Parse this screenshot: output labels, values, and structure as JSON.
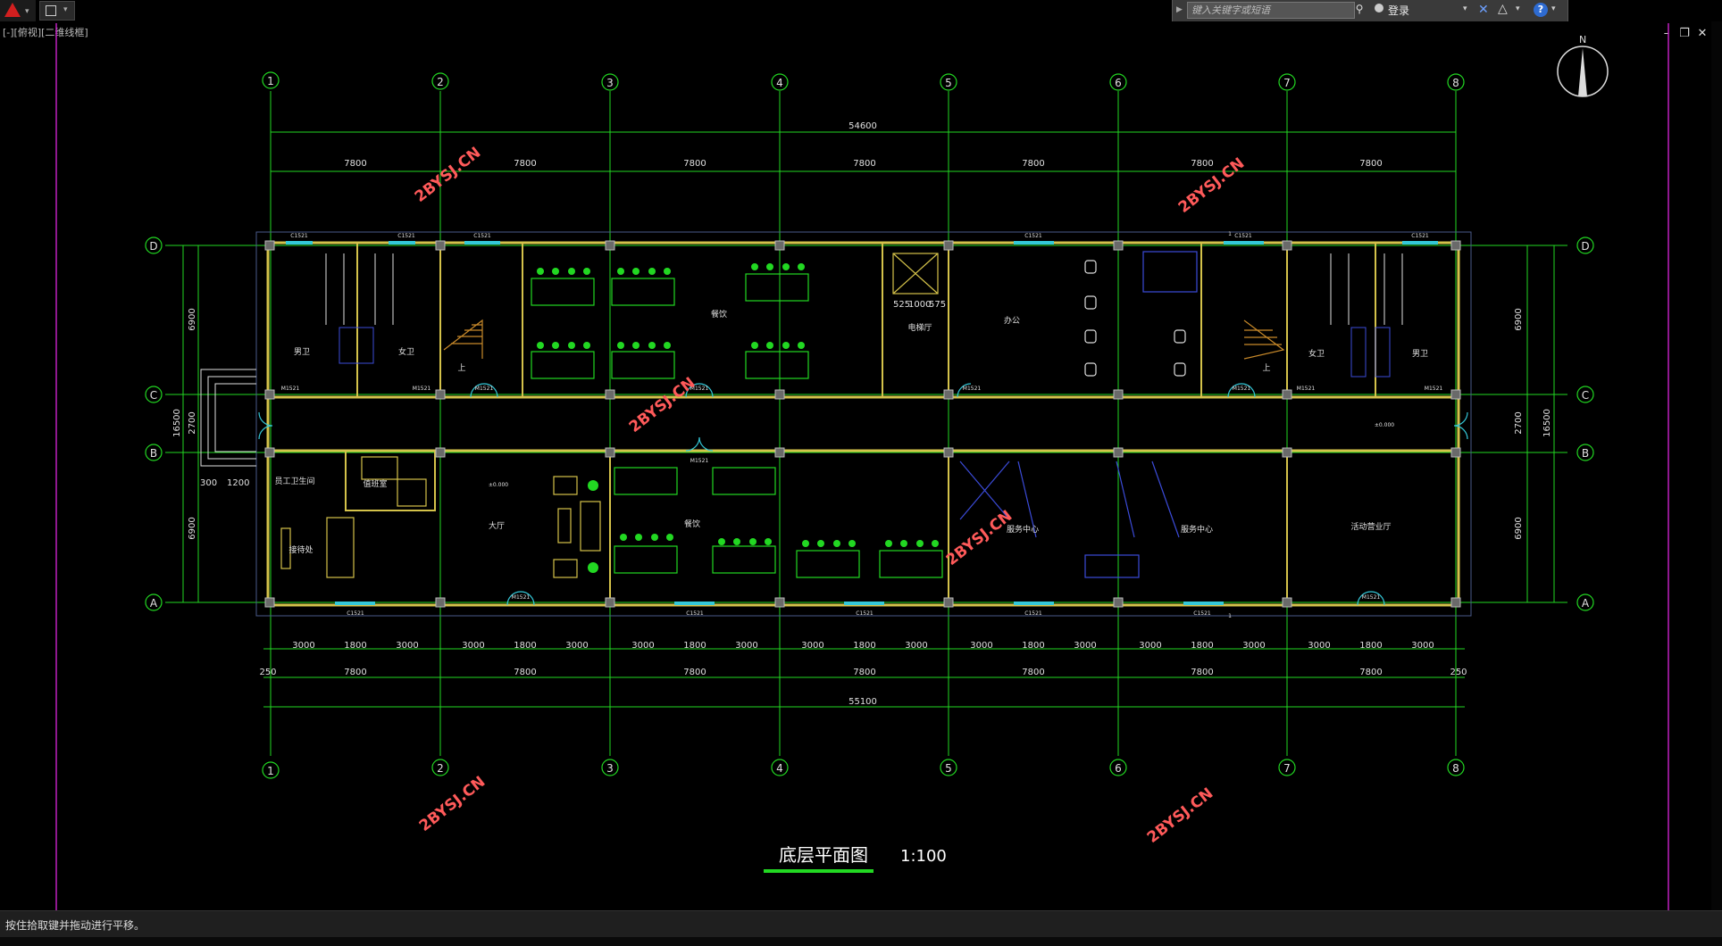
{
  "toolbar": {
    "app_logo": "autocad-a-icon",
    "search_placeholder": "键入关键字或短语",
    "login_label": "登录"
  },
  "window": {
    "minimize": "–",
    "restore": "❐",
    "close": "✕"
  },
  "viewport_label": "[-][俯视][二维线框]",
  "drawing": {
    "title": "底层平面图",
    "scale": "1:100",
    "north": "N",
    "watermark": "2BYSJ.CN",
    "grid_x": [
      "1",
      "2",
      "3",
      "4",
      "5",
      "6",
      "7",
      "8"
    ],
    "grid_y": [
      "D",
      "C",
      "B",
      "A"
    ],
    "top_total": "54600",
    "bottom_total": "55100",
    "bay": "7800",
    "bottom_small": [
      "3000",
      "1800",
      "3000"
    ],
    "edge": "250",
    "left_dims": [
      "6900",
      "2700",
      "6900"
    ],
    "left_total": "16500",
    "left_small": [
      "300",
      "1200"
    ],
    "door_dims": [
      "525",
      "1000",
      "575"
    ],
    "rooms": {
      "male_wc_l": "男卫",
      "female_wc_l": "女卫",
      "dining_top": "餐饮",
      "elevator": "电梯厅",
      "office": "办公",
      "female_wc_r": "女卫",
      "male_wc_r": "男卫",
      "staff_wc": "员工卫生间",
      "duty": "值班室",
      "lobby": "大厅",
      "dining_bottom": "餐饮",
      "reception": "接待处",
      "service_1": "服务中心",
      "service_2": "服务中心",
      "activity": "活动营业厅",
      "stairs_up": "上"
    },
    "labels": {
      "door": "M1521",
      "window": "C1521",
      "elev": "±0.000",
      "section": "1"
    }
  },
  "status": {
    "text": "按住拾取键并拖动进行平移。"
  }
}
